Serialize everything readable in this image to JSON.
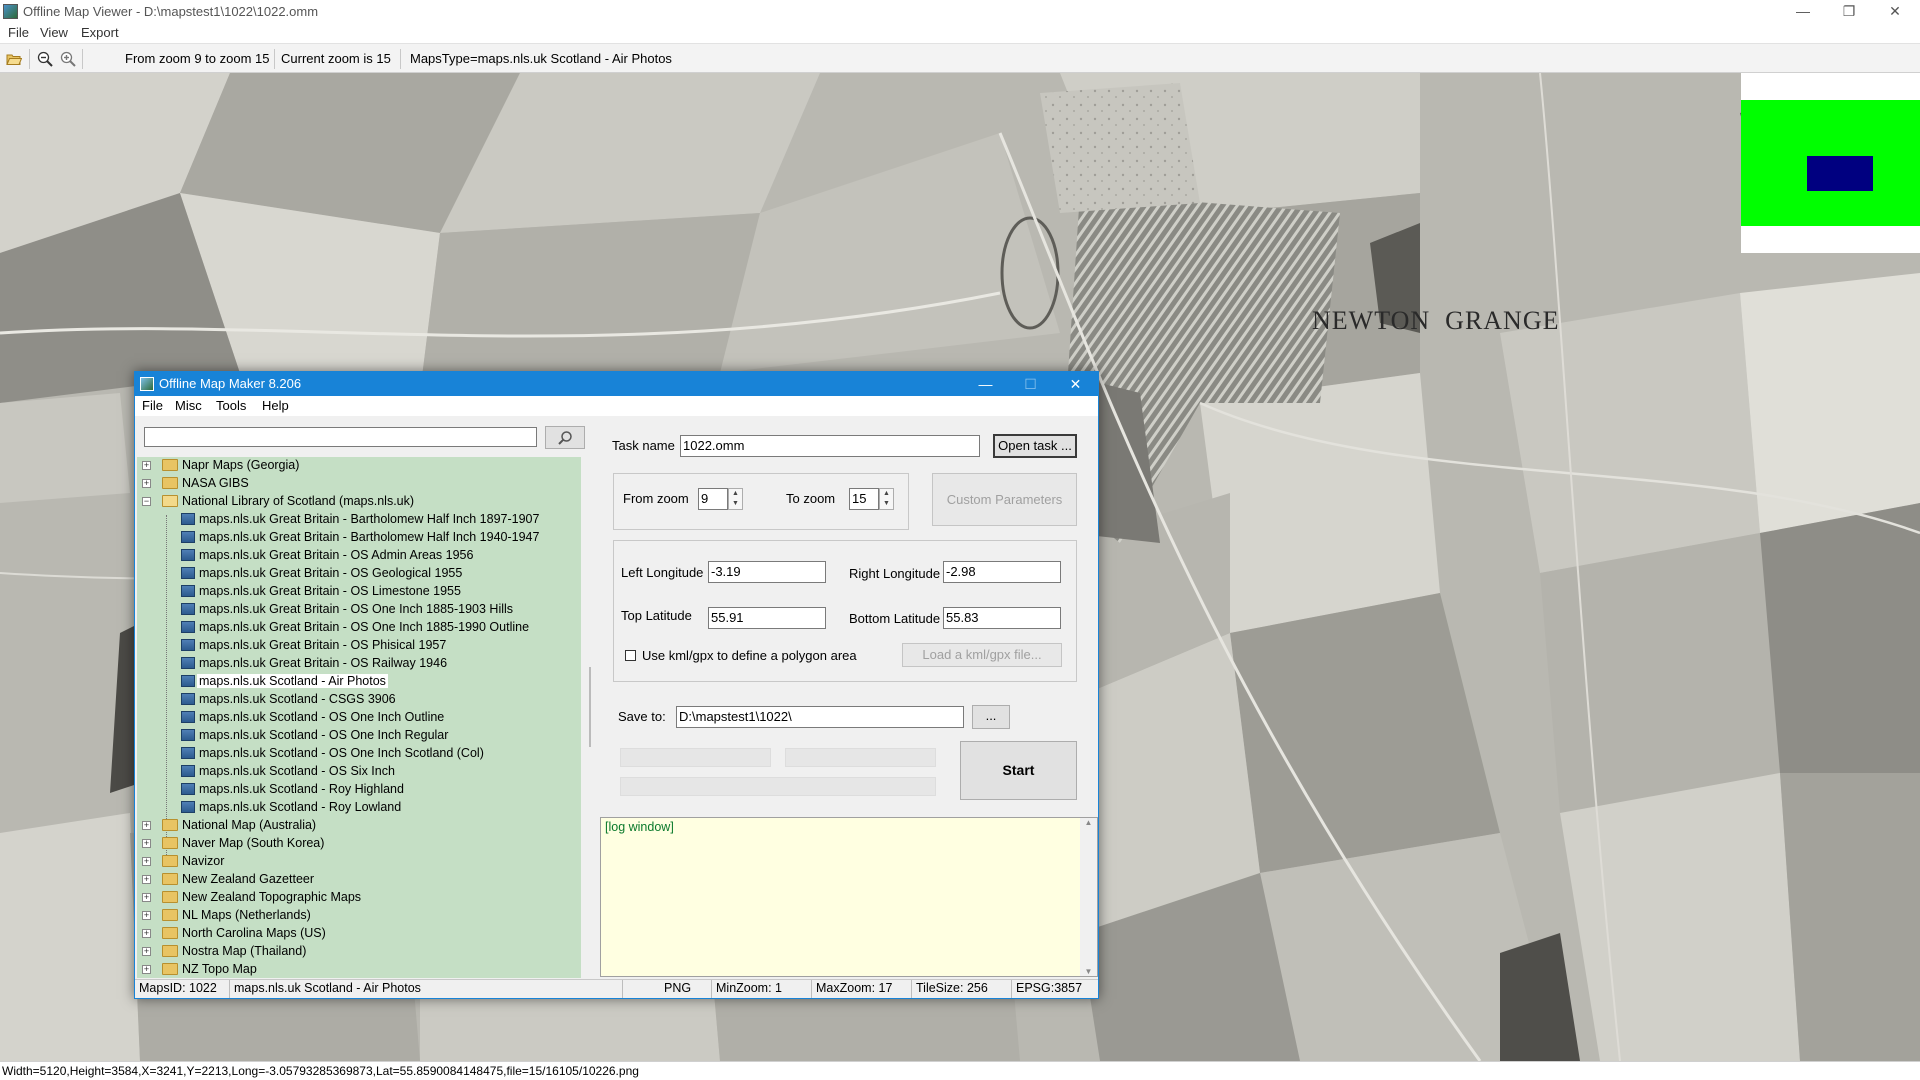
{
  "window": {
    "title": "Offline Map Viewer - D:\\mapstest1\\1022\\1022.omm",
    "menu": [
      "File",
      "View",
      "Export"
    ],
    "controls": {
      "minimize": "—",
      "maximize": "❐",
      "close": "✕"
    }
  },
  "toolbar": {
    "icons": [
      "open-folder-icon",
      "zoom-out-icon",
      "zoom-in-icon"
    ],
    "zoom_range": "From zoom 9 to zoom 15",
    "current_zoom": "Current zoom is 15",
    "maps_type": "MapsType=maps.nls.uk Scotland - Air Photos"
  },
  "map": {
    "label": "NEWTON  GRANGE",
    "overview_colors": {
      "background": "#00ff00",
      "viewport": "#000080"
    }
  },
  "status": {
    "text": "Width=5120,Height=3584,X=3241,Y=2213,Long=-3.05793285369873,Lat=55.8590084148475,file=15/16105/10226.png"
  },
  "dialog": {
    "title": "Offline Map Maker 8.206",
    "menu": [
      "File",
      "Misc",
      "Tools",
      "Help"
    ],
    "search": {
      "value": "",
      "placeholder": ""
    },
    "tree": {
      "top_nodes_before": [
        "Napr Maps (Georgia)",
        "NASA GIBS"
      ],
      "expanded_node": "National Library of Scotland (maps.nls.uk)",
      "children": [
        "maps.nls.uk Great Britain - Bartholomew Half Inch 1897-1907",
        "maps.nls.uk Great Britain - Bartholomew Half Inch 1940-1947",
        "maps.nls.uk Great Britain - OS Admin Areas 1956",
        "maps.nls.uk Great Britain - OS Geological 1955",
        "maps.nls.uk Great Britain - OS Limestone 1955",
        "maps.nls.uk Great Britain - OS One Inch 1885-1903 Hills",
        "maps.nls.uk Great Britain - OS One Inch 1885-1990 Outline",
        "maps.nls.uk Great Britain - OS Phisical 1957",
        "maps.nls.uk Great Britain - OS Railway 1946",
        "maps.nls.uk Scotland - Air Photos",
        "maps.nls.uk Scotland - CSGS 3906",
        "maps.nls.uk Scotland - OS One Inch Outline",
        "maps.nls.uk Scotland - OS One Inch Regular",
        "maps.nls.uk Scotland - OS One Inch Scotland (Col)",
        "maps.nls.uk Scotland - OS Six Inch",
        "maps.nls.uk Scotland - Roy Highland",
        "maps.nls.uk Scotland - Roy Lowland"
      ],
      "selected_child": "maps.nls.uk Scotland - Air Photos",
      "top_nodes_after": [
        "National Map (Australia)",
        "Naver Map (South Korea)",
        "Navizor",
        "New Zealand Gazetteer",
        "New Zealand Topographic Maps",
        "NL Maps (Netherlands)",
        "North Carolina Maps (US)",
        "Nostra Map (Thailand)",
        "NZ Topo Map"
      ]
    },
    "task_name_label": "Task name",
    "task_name": "1022.omm",
    "open_task": "Open task ...",
    "from_zoom_label": "From zoom",
    "from_zoom": "9",
    "to_zoom_label": "To zoom",
    "to_zoom": "15",
    "custom_params": "Custom Parameters",
    "left_lon_label": "Left Longitude",
    "left_lon": "-3.19",
    "right_lon_label": "Right Longitude",
    "right_lon": "-2.98",
    "top_lat_label": "Top Latitude",
    "top_lat": "55.91",
    "bottom_lat_label": "Bottom Latitude",
    "bottom_lat": "55.83",
    "kml_checkbox": "Use kml/gpx to define a polygon area",
    "kml_checked": false,
    "load_kml": "Load a kml/gpx file...",
    "save_to_label": "Save to:",
    "save_to": "D:\\mapstest1\\1022\\",
    "browse": "...",
    "start": "Start",
    "log": "[log window]",
    "status": {
      "maps_id": "MapsID: 1022",
      "maps_name": "maps.nls.uk Scotland - Air Photos",
      "format": "PNG",
      "min_zoom": "MinZoom: 1",
      "max_zoom": "MaxZoom: 17",
      "tile_size": "TileSize: 256",
      "epsg": "EPSG:3857"
    }
  }
}
